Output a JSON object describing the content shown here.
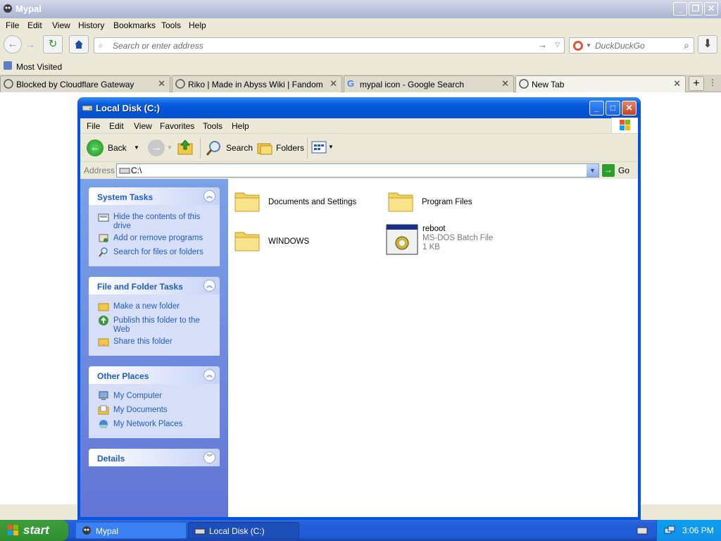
{
  "browser": {
    "title": "Mypal",
    "menu": [
      "File",
      "Edit",
      "View",
      "History",
      "Bookmarks",
      "Tools",
      "Help"
    ],
    "url_placeholder": "Search or enter address",
    "search_placeholder": "DuckDuckGo",
    "bookmarks": [
      "Most Visited"
    ],
    "tabs": [
      {
        "label": "Blocked by Cloudflare Gateway"
      },
      {
        "label": "Riko | Made in Abyss Wiki | Fandom"
      },
      {
        "label": "mypal icon - Google Search"
      },
      {
        "label": "New Tab"
      }
    ]
  },
  "explorer": {
    "title": "Local Disk (C:)",
    "menu": [
      "File",
      "Edit",
      "View",
      "Favorites",
      "Tools",
      "Help"
    ],
    "toolbar": {
      "back": "Back",
      "search": "Search",
      "folders": "Folders"
    },
    "address_label": "Address",
    "address_value": "C:\\",
    "go_label": "Go",
    "panels": [
      {
        "title": "System Tasks",
        "links": [
          "Hide the contents of this drive",
          "Add or remove programs",
          "Search for files or folders"
        ]
      },
      {
        "title": "File and Folder Tasks",
        "links": [
          "Make a new folder",
          "Publish this folder to the Web",
          "Share this folder"
        ]
      },
      {
        "title": "Other Places",
        "links": [
          "My Computer",
          "My Documents",
          "My Network Places"
        ]
      },
      {
        "title": "Details",
        "links": []
      }
    ],
    "items": [
      {
        "name": "Documents and Settings"
      },
      {
        "name": "Program Files"
      },
      {
        "name": "WINDOWS"
      },
      {
        "name": "reboot",
        "type": "MS-DOS Batch File",
        "size": "1 KB"
      }
    ]
  },
  "taskbar": {
    "start": "start",
    "buttons": [
      "Mypal",
      "Local Disk (C:)"
    ],
    "clock": "3:06 PM"
  }
}
